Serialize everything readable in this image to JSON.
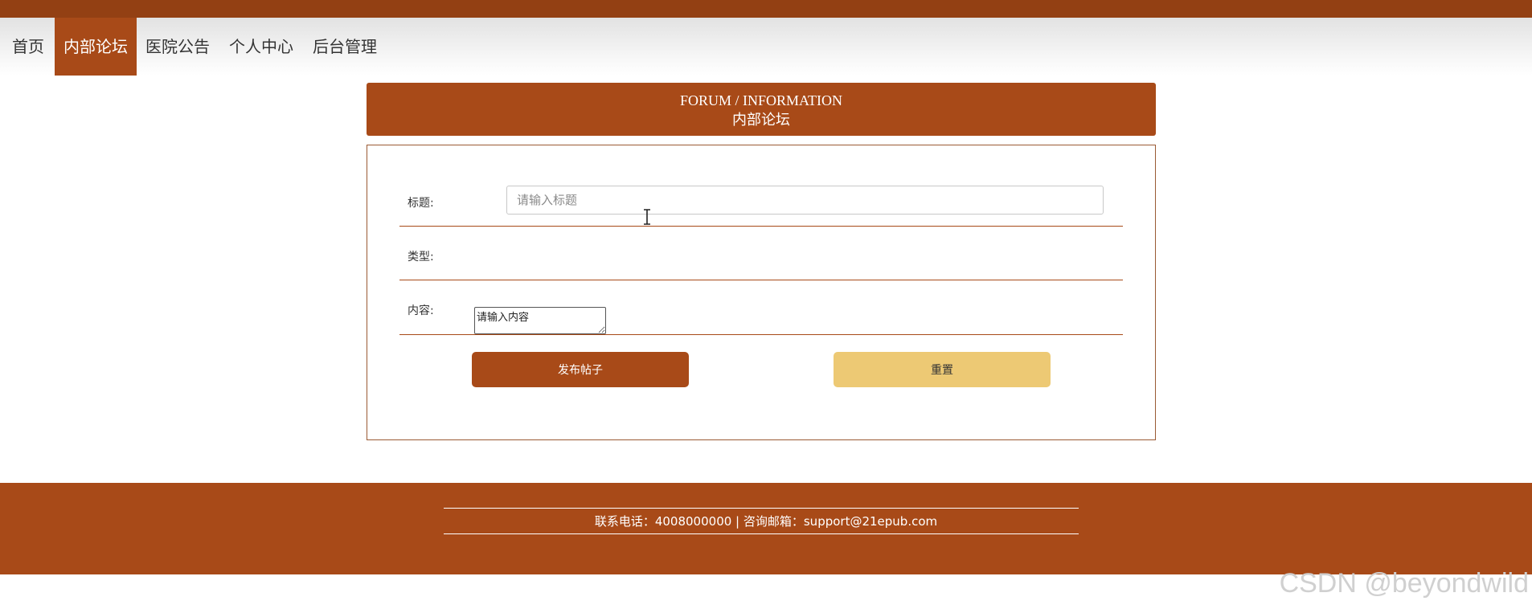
{
  "nav": {
    "items": [
      {
        "label": "首页"
      },
      {
        "label": "内部论坛",
        "active": true
      },
      {
        "label": "医院公告"
      },
      {
        "label": "个人中心"
      },
      {
        "label": "后台管理"
      }
    ]
  },
  "banner": {
    "english_title": "FORUM / INFORMATION",
    "chinese_title": "内部论坛"
  },
  "form": {
    "title_label": "标题:",
    "title_placeholder": "请输入标题",
    "type_label": "类型:",
    "content_label": "内容:",
    "content_placeholder": "请输入内容",
    "publish_label": "发布帖子",
    "reset_label": "重置"
  },
  "footer": {
    "contact_text": "联系电话：4008000000 | 咨询邮箱：support@21epub.com"
  },
  "watermark": "CSDN @beyondwild",
  "colors": {
    "top_strip": "#934013",
    "brand": "#a84a18",
    "reset_button": "#edc974",
    "white": "#ffffff"
  },
  "icons": {
    "cursor": "text-cursor-icon"
  }
}
